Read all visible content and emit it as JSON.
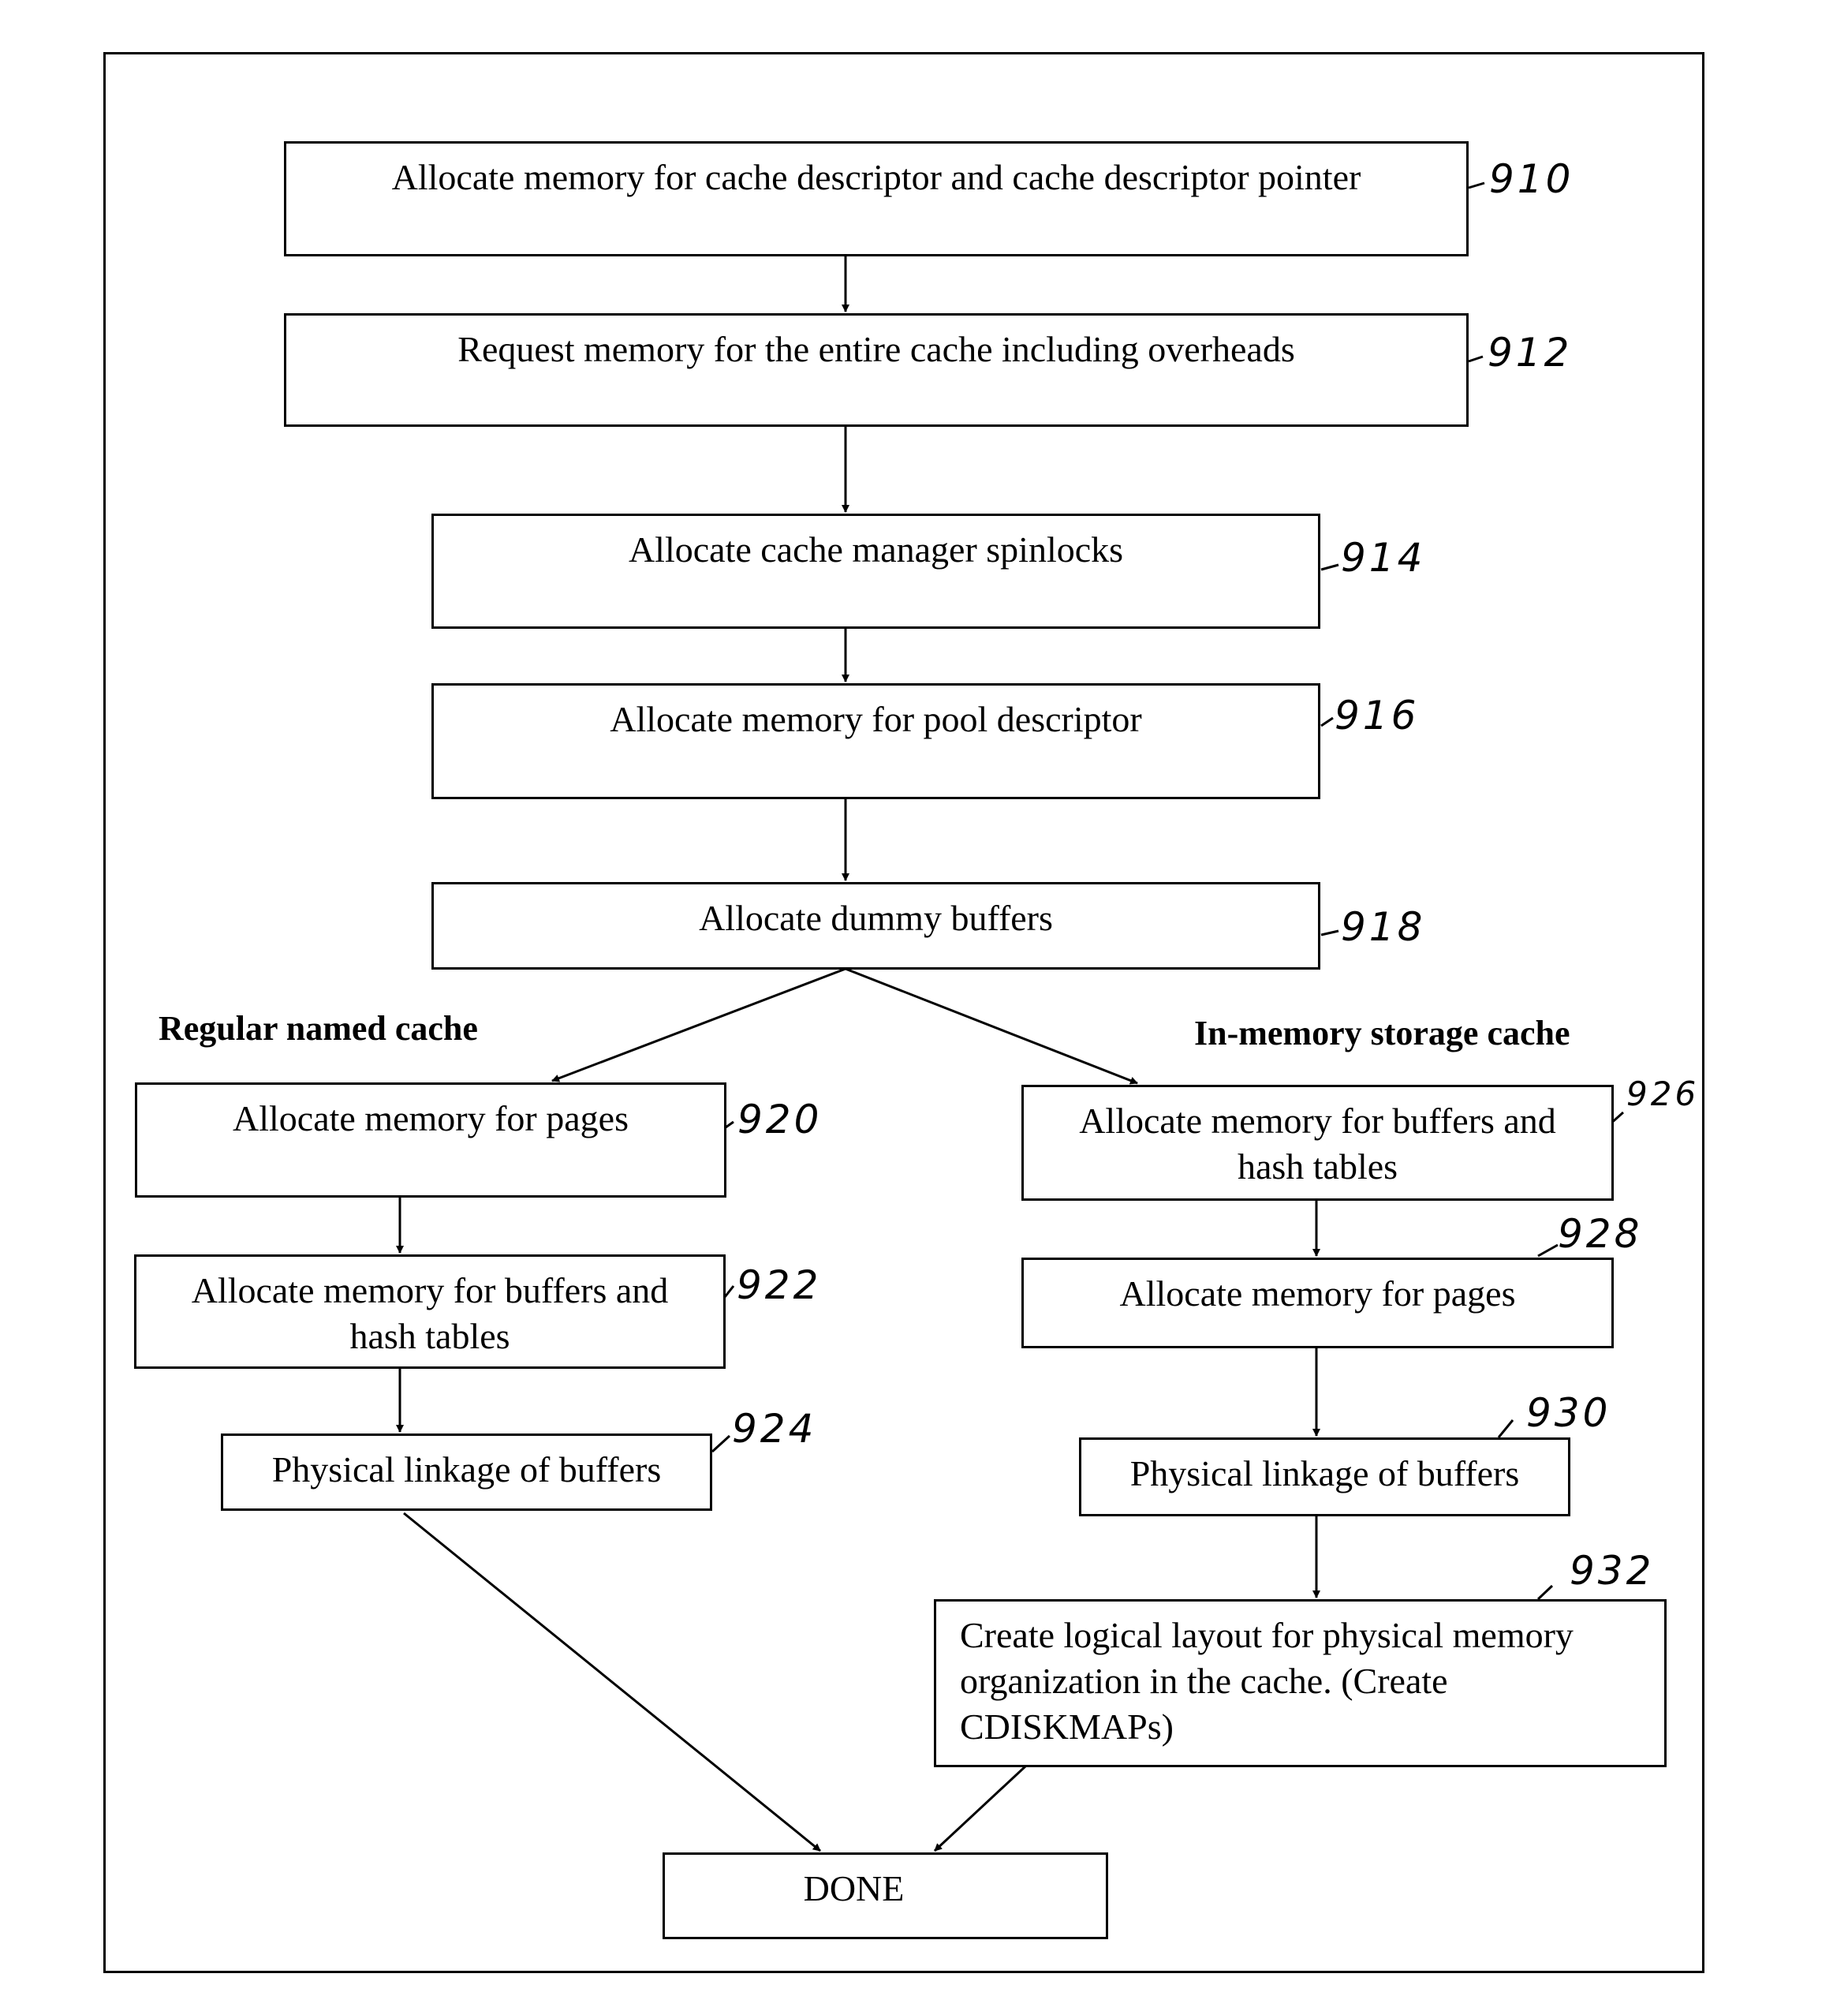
{
  "diagram": {
    "type": "flowchart",
    "steps": {
      "s910": {
        "ref": "910",
        "text": "Allocate memory for cache descriptor and cache descriptor pointer"
      },
      "s912": {
        "ref": "912",
        "text": "Request memory for the entire cache including overheads"
      },
      "s914": {
        "ref": "914",
        "text": "Allocate cache manager spinlocks"
      },
      "s916": {
        "ref": "916",
        "text": "Allocate memory for pool descriptor"
      },
      "s918": {
        "ref": "918",
        "text": "Allocate dummy buffers"
      },
      "s920": {
        "ref": "920",
        "text": "Allocate memory for pages"
      },
      "s922": {
        "ref": "922",
        "text": "Allocate memory for buffers and hash tables"
      },
      "s924": {
        "ref": "924",
        "text": "Physical linkage of buffers"
      },
      "s926": {
        "ref": "926",
        "text": "Allocate memory for buffers and hash tables"
      },
      "s928": {
        "ref": "928",
        "text": "Allocate memory for pages"
      },
      "s930": {
        "ref": "930",
        "text": "Physical linkage of buffers"
      },
      "s932": {
        "ref": "932",
        "text": "Create logical layout for physical memory organization in the cache. (Create CDISKMAPs)"
      },
      "done": {
        "text": "DONE"
      }
    },
    "branches": {
      "left": {
        "label": "Regular named cache"
      },
      "right": {
        "label": "In-memory storage cache"
      }
    },
    "edges": [
      [
        "s910",
        "s912"
      ],
      [
        "s912",
        "s914"
      ],
      [
        "s914",
        "s916"
      ],
      [
        "s916",
        "s918"
      ],
      [
        "s918",
        "s920"
      ],
      [
        "s918",
        "s926"
      ],
      [
        "s920",
        "s922"
      ],
      [
        "s922",
        "s924"
      ],
      [
        "s924",
        "done"
      ],
      [
        "s926",
        "s928"
      ],
      [
        "s928",
        "s930"
      ],
      [
        "s930",
        "s932"
      ],
      [
        "s932",
        "done"
      ]
    ]
  }
}
